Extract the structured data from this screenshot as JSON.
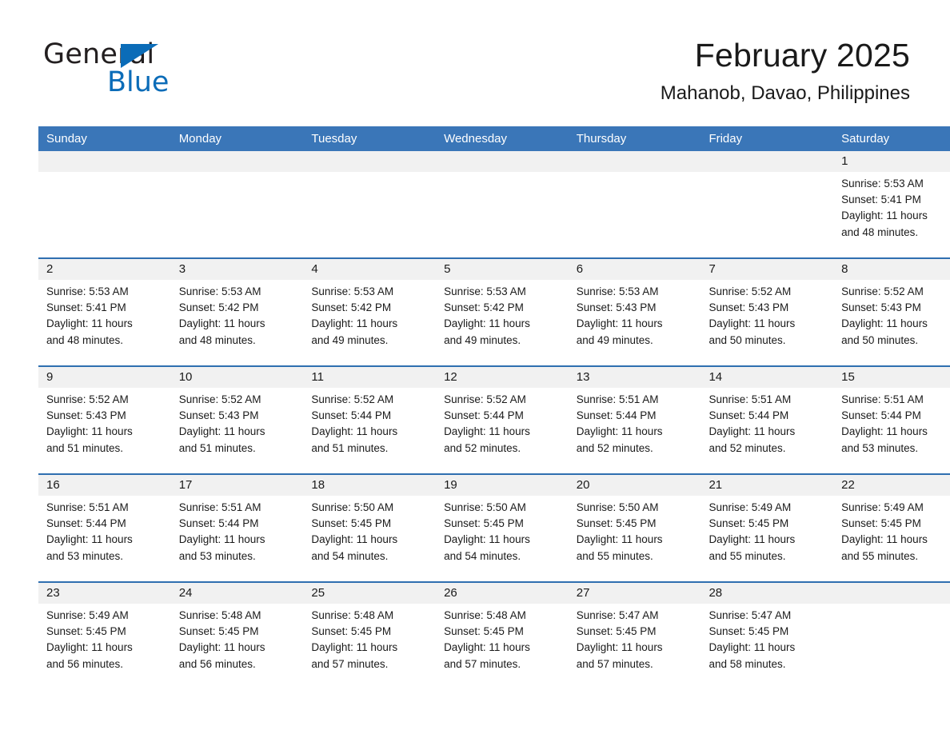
{
  "brand": {
    "name_part1": "General",
    "name_part2": "Blue",
    "accent_color": "#0b6cb8"
  },
  "header": {
    "title": "February 2025",
    "location": "Mahanob, Davao, Philippines"
  },
  "theme": {
    "header_row_bg": "#3a76b8",
    "row_divider": "#2f6fb0",
    "daynum_band_bg": "#f1f1f1"
  },
  "weekdays": [
    "Sunday",
    "Monday",
    "Tuesday",
    "Wednesday",
    "Thursday",
    "Friday",
    "Saturday"
  ],
  "weeks": [
    [
      {
        "day": "",
        "lines": []
      },
      {
        "day": "",
        "lines": []
      },
      {
        "day": "",
        "lines": []
      },
      {
        "day": "",
        "lines": []
      },
      {
        "day": "",
        "lines": []
      },
      {
        "day": "",
        "lines": []
      },
      {
        "day": "1",
        "lines": [
          "Sunrise: 5:53 AM",
          "Sunset: 5:41 PM",
          "Daylight: 11 hours",
          "and 48 minutes."
        ]
      }
    ],
    [
      {
        "day": "2",
        "lines": [
          "Sunrise: 5:53 AM",
          "Sunset: 5:41 PM",
          "Daylight: 11 hours",
          "and 48 minutes."
        ]
      },
      {
        "day": "3",
        "lines": [
          "Sunrise: 5:53 AM",
          "Sunset: 5:42 PM",
          "Daylight: 11 hours",
          "and 48 minutes."
        ]
      },
      {
        "day": "4",
        "lines": [
          "Sunrise: 5:53 AM",
          "Sunset: 5:42 PM",
          "Daylight: 11 hours",
          "and 49 minutes."
        ]
      },
      {
        "day": "5",
        "lines": [
          "Sunrise: 5:53 AM",
          "Sunset: 5:42 PM",
          "Daylight: 11 hours",
          "and 49 minutes."
        ]
      },
      {
        "day": "6",
        "lines": [
          "Sunrise: 5:53 AM",
          "Sunset: 5:43 PM",
          "Daylight: 11 hours",
          "and 49 minutes."
        ]
      },
      {
        "day": "7",
        "lines": [
          "Sunrise: 5:52 AM",
          "Sunset: 5:43 PM",
          "Daylight: 11 hours",
          "and 50 minutes."
        ]
      },
      {
        "day": "8",
        "lines": [
          "Sunrise: 5:52 AM",
          "Sunset: 5:43 PM",
          "Daylight: 11 hours",
          "and 50 minutes."
        ]
      }
    ],
    [
      {
        "day": "9",
        "lines": [
          "Sunrise: 5:52 AM",
          "Sunset: 5:43 PM",
          "Daylight: 11 hours",
          "and 51 minutes."
        ]
      },
      {
        "day": "10",
        "lines": [
          "Sunrise: 5:52 AM",
          "Sunset: 5:43 PM",
          "Daylight: 11 hours",
          "and 51 minutes."
        ]
      },
      {
        "day": "11",
        "lines": [
          "Sunrise: 5:52 AM",
          "Sunset: 5:44 PM",
          "Daylight: 11 hours",
          "and 51 minutes."
        ]
      },
      {
        "day": "12",
        "lines": [
          "Sunrise: 5:52 AM",
          "Sunset: 5:44 PM",
          "Daylight: 11 hours",
          "and 52 minutes."
        ]
      },
      {
        "day": "13",
        "lines": [
          "Sunrise: 5:51 AM",
          "Sunset: 5:44 PM",
          "Daylight: 11 hours",
          "and 52 minutes."
        ]
      },
      {
        "day": "14",
        "lines": [
          "Sunrise: 5:51 AM",
          "Sunset: 5:44 PM",
          "Daylight: 11 hours",
          "and 52 minutes."
        ]
      },
      {
        "day": "15",
        "lines": [
          "Sunrise: 5:51 AM",
          "Sunset: 5:44 PM",
          "Daylight: 11 hours",
          "and 53 minutes."
        ]
      }
    ],
    [
      {
        "day": "16",
        "lines": [
          "Sunrise: 5:51 AM",
          "Sunset: 5:44 PM",
          "Daylight: 11 hours",
          "and 53 minutes."
        ]
      },
      {
        "day": "17",
        "lines": [
          "Sunrise: 5:51 AM",
          "Sunset: 5:44 PM",
          "Daylight: 11 hours",
          "and 53 minutes."
        ]
      },
      {
        "day": "18",
        "lines": [
          "Sunrise: 5:50 AM",
          "Sunset: 5:45 PM",
          "Daylight: 11 hours",
          "and 54 minutes."
        ]
      },
      {
        "day": "19",
        "lines": [
          "Sunrise: 5:50 AM",
          "Sunset: 5:45 PM",
          "Daylight: 11 hours",
          "and 54 minutes."
        ]
      },
      {
        "day": "20",
        "lines": [
          "Sunrise: 5:50 AM",
          "Sunset: 5:45 PM",
          "Daylight: 11 hours",
          "and 55 minutes."
        ]
      },
      {
        "day": "21",
        "lines": [
          "Sunrise: 5:49 AM",
          "Sunset: 5:45 PM",
          "Daylight: 11 hours",
          "and 55 minutes."
        ]
      },
      {
        "day": "22",
        "lines": [
          "Sunrise: 5:49 AM",
          "Sunset: 5:45 PM",
          "Daylight: 11 hours",
          "and 55 minutes."
        ]
      }
    ],
    [
      {
        "day": "23",
        "lines": [
          "Sunrise: 5:49 AM",
          "Sunset: 5:45 PM",
          "Daylight: 11 hours",
          "and 56 minutes."
        ]
      },
      {
        "day": "24",
        "lines": [
          "Sunrise: 5:48 AM",
          "Sunset: 5:45 PM",
          "Daylight: 11 hours",
          "and 56 minutes."
        ]
      },
      {
        "day": "25",
        "lines": [
          "Sunrise: 5:48 AM",
          "Sunset: 5:45 PM",
          "Daylight: 11 hours",
          "and 57 minutes."
        ]
      },
      {
        "day": "26",
        "lines": [
          "Sunrise: 5:48 AM",
          "Sunset: 5:45 PM",
          "Daylight: 11 hours",
          "and 57 minutes."
        ]
      },
      {
        "day": "27",
        "lines": [
          "Sunrise: 5:47 AM",
          "Sunset: 5:45 PM",
          "Daylight: 11 hours",
          "and 57 minutes."
        ]
      },
      {
        "day": "28",
        "lines": [
          "Sunrise: 5:47 AM",
          "Sunset: 5:45 PM",
          "Daylight: 11 hours",
          "and 58 minutes."
        ]
      },
      {
        "day": "",
        "lines": []
      }
    ]
  ]
}
